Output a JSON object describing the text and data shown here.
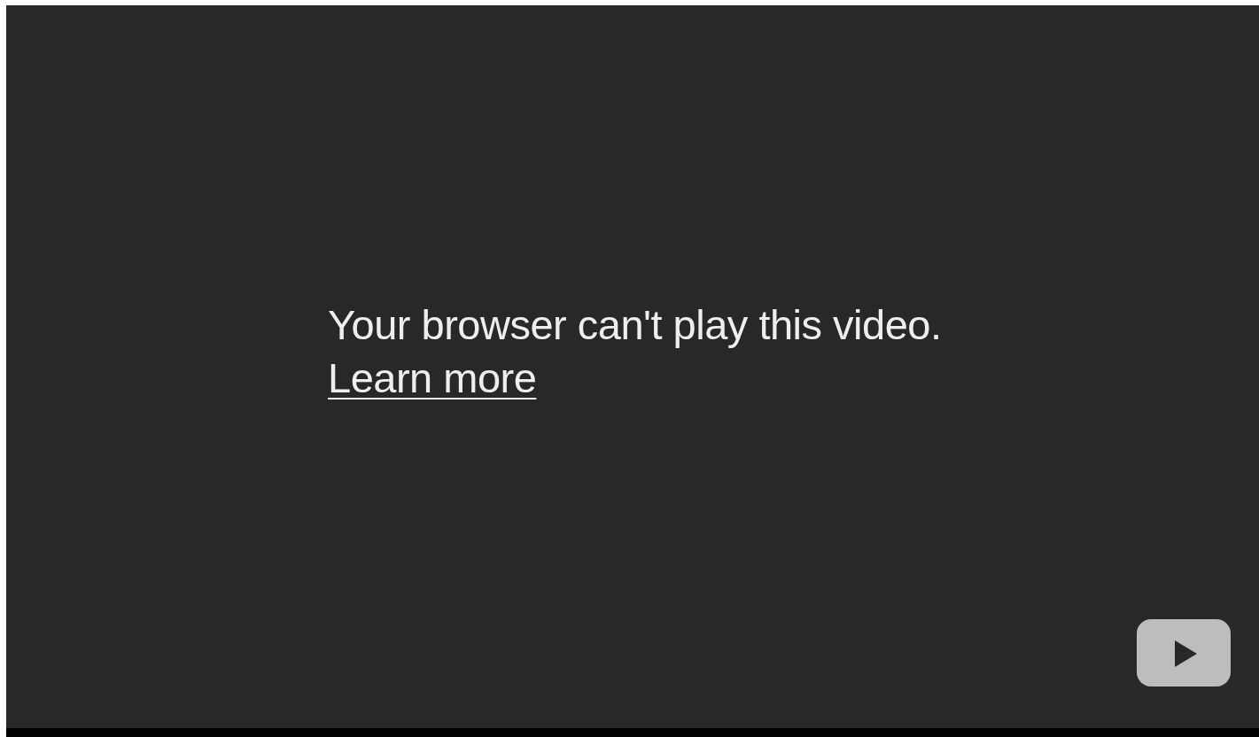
{
  "player": {
    "message": "Your browser can't play this video.",
    "link": "Learn more"
  }
}
